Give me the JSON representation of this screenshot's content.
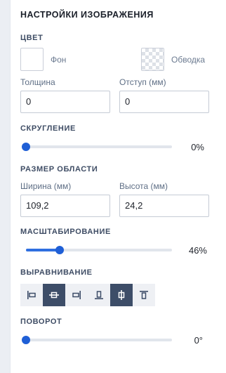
{
  "title": "НАСТРОЙКИ ИЗОБРАЖЕНИЯ",
  "color": {
    "section": "ЦВЕТ",
    "background_label": "Фон",
    "stroke_label": "Обводка"
  },
  "thickness": {
    "label": "Толщина",
    "value": "0"
  },
  "padding": {
    "label": "Отступ (мм)",
    "value": "0"
  },
  "rounding": {
    "section": "СКРУГЛЕНИЕ",
    "value_text": "0%",
    "fraction": 0
  },
  "area": {
    "section": "РАЗМЕР ОБЛАСТИ",
    "width_label": "Ширина (мм)",
    "width_value": "109,2",
    "height_label": "Высота (мм)",
    "height_value": "24,2"
  },
  "scaling": {
    "section": "МАСШТАБИРОВАНИЕ",
    "value_text": "46%",
    "fraction": 0.23
  },
  "alignment": {
    "section": "ВЫРАВНИВАНИЕ",
    "buttons": [
      {
        "icon": "align-left-icon",
        "active": false
      },
      {
        "icon": "align-center-horizontal-icon",
        "active": true
      },
      {
        "icon": "align-right-icon",
        "active": false
      },
      {
        "icon": "align-bottom-icon",
        "active": false
      },
      {
        "icon": "align-center-vertical-icon",
        "active": true
      },
      {
        "icon": "align-top-icon",
        "active": false
      }
    ]
  },
  "rotation": {
    "section": "ПОВОРОТ",
    "value_text": "0°",
    "fraction": 0
  },
  "colors": {
    "accent": "#1f5fd6",
    "active_button": "#3d4d68"
  }
}
